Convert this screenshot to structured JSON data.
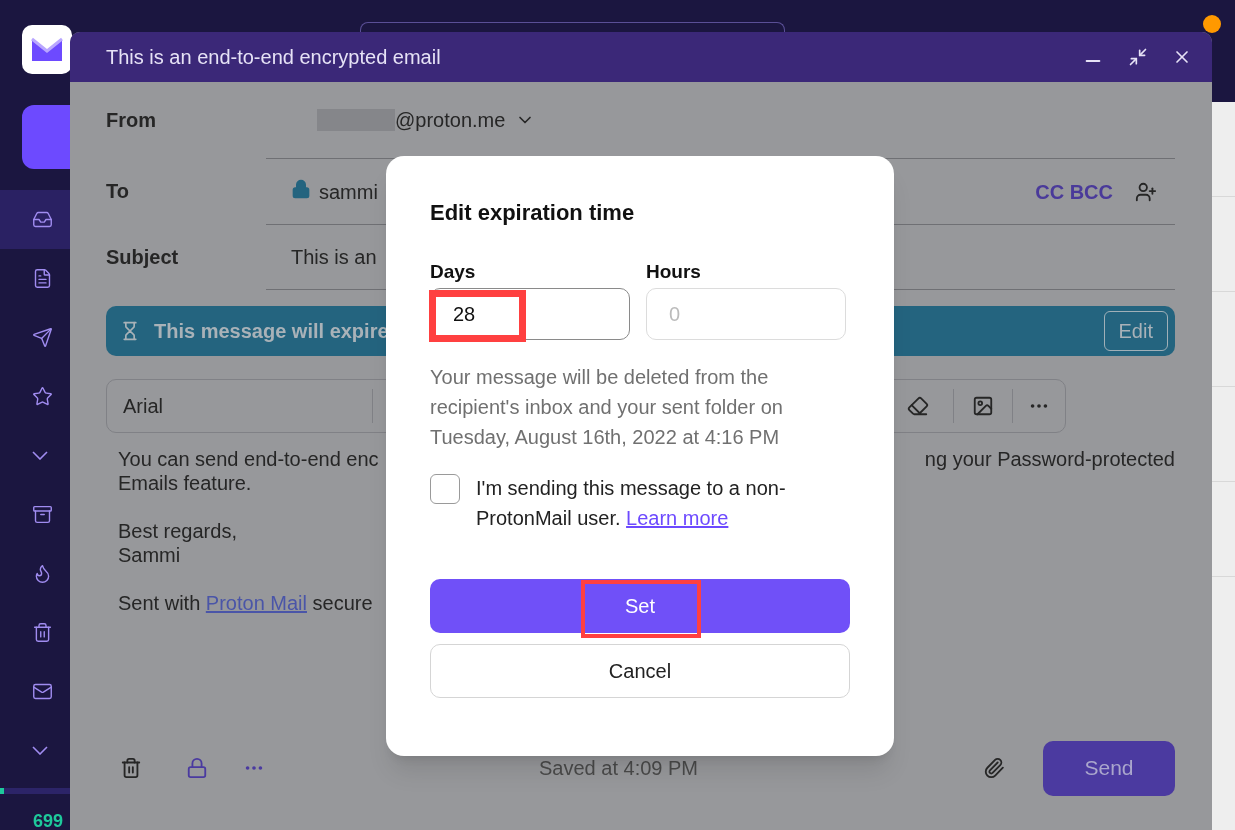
{
  "sidebar": {
    "items": [
      {
        "kind": "inbox",
        "selected": true
      },
      {
        "kind": "drafts",
        "selected": false
      },
      {
        "kind": "sent",
        "selected": false
      },
      {
        "kind": "starred",
        "selected": false
      },
      {
        "kind": "expand",
        "selected": false
      },
      {
        "kind": "archive",
        "selected": false
      },
      {
        "kind": "spam",
        "selected": false
      },
      {
        "kind": "trash",
        "selected": false
      },
      {
        "kind": "allmail",
        "selected": false
      },
      {
        "kind": "expand",
        "selected": false
      }
    ],
    "storage": "699"
  },
  "composer": {
    "title": "This is an end-to-end encrypted email",
    "from": {
      "label": "From",
      "address": "@proton.me"
    },
    "to": {
      "label": "To",
      "recipient": "sammi",
      "cc_bcc": "CC BCC"
    },
    "subject": {
      "label": "Subject",
      "value": "This is an"
    },
    "expiry_banner": {
      "text": "This message will expire",
      "button": "Edit"
    },
    "toolbar": {
      "font": "Arial"
    },
    "body": {
      "first_line_start": "You can send end-to-end enc",
      "first_line_end": "ng your Password-protected",
      "paragraphs": [
        [
          "Emails feature."
        ],
        [
          "Best regards,",
          "Sammi"
        ]
      ],
      "signature": {
        "before": "Sent with",
        "link": "Proton Mail",
        "after": "secure"
      }
    },
    "footer": {
      "saved": "Saved at 4:09 PM",
      "send": "Send"
    }
  },
  "dialog": {
    "title": "Edit expiration time",
    "days": {
      "label": "Days",
      "value": "28"
    },
    "hours": {
      "label": "Hours",
      "placeholder": "0"
    },
    "description": "Your message will be deleted from the recipient's inbox and your sent folder on Tuesday, August 16th, 2022 at 4:16 PM",
    "checkbox": {
      "label": "I'm sending this message to a non-ProtonMail user.",
      "link": "Learn more",
      "checked": false
    },
    "set": "Set",
    "cancel": "Cancel"
  }
}
